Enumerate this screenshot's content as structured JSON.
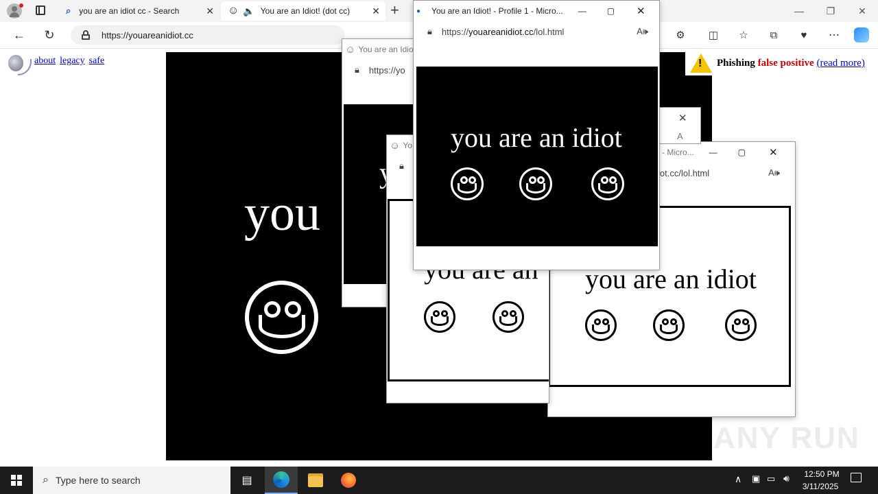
{
  "browser": {
    "tabs": [
      {
        "title": "you are an idiot cc - Search"
      },
      {
        "title": "You are an Idiot! (dot cc)"
      }
    ],
    "url": "https://youareanidiot.cc"
  },
  "page": {
    "links": [
      "about",
      "legacy",
      "safe"
    ],
    "banner": {
      "word1": "Phishing",
      "word2": "false positive",
      "link": "(read more)"
    },
    "main_text": "you",
    "bg_color": "#000000",
    "watermark": "ANY RUN"
  },
  "popups": {
    "front": {
      "title": "You are an Idiot! - Profile 1 - Micro...",
      "url_prefix": "https://",
      "url_domain": "youareanidiot.cc",
      "url_path": "/lol.html",
      "text": "you are an idiot"
    },
    "back1": {
      "title": "You are an Idiot!",
      "url": "https://yo"
    },
    "back2": {
      "title": "Yo",
      "text": "you are an"
    },
    "back3": {
      "title": "- Micro...",
      "url": "iot.cc/lol.html",
      "text": "you are an idiot"
    },
    "back1_text": "y"
  },
  "taskbar": {
    "search_placeholder": "Type here to search",
    "time": "12:50 PM",
    "date": "3/11/2025"
  }
}
